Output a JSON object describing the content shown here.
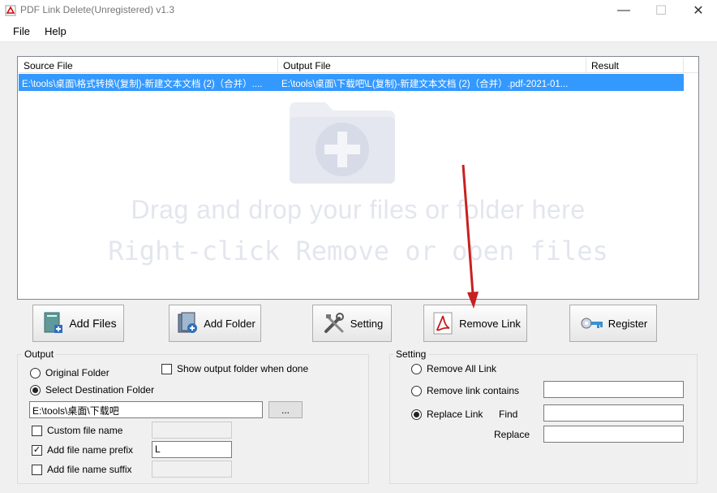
{
  "window": {
    "title": "PDF Link Delete(Unregistered) v1.3",
    "minimize": "—",
    "maximize": "☐",
    "close": "✕"
  },
  "menu": {
    "file": "File",
    "help": "Help"
  },
  "list": {
    "headers": {
      "source": "Source File",
      "output": "Output File",
      "result": "Result"
    },
    "rows": [
      {
        "source": "E:\\tools\\桌面\\格式转换\\(复制)-新建文本文档 (2)（合并）....",
        "output": "E:\\tools\\桌面\\下载吧\\L(复制)-新建文本文档 (2)（合并）.pdf-2021-01...",
        "result": ""
      }
    ],
    "drop_line1": "Drag and drop your files or folder here",
    "drop_line2": "Right-click Remove or open files"
  },
  "buttons": {
    "add_files": "Add Files",
    "add_folder": "Add Folder",
    "setting": "Setting",
    "remove_link": "Remove Link",
    "register": "Register"
  },
  "output": {
    "title": "Output",
    "original_folder": "Original Folder",
    "show_output": "Show output folder when done",
    "select_dest": "Select Destination Folder",
    "dest_path": "E:\\tools\\桌面\\下载吧",
    "browse": "...",
    "custom_name": "Custom file name",
    "custom_name_value": "",
    "prefix_label": "Add file name prefix",
    "prefix_value": "L",
    "suffix_label": "Add file name suffix",
    "suffix_value": ""
  },
  "setting": {
    "title": "Setting",
    "remove_all": "Remove All Link",
    "remove_contains": "Remove link contains",
    "remove_contains_value": "",
    "replace_link": "Replace Link",
    "find_label": "Find",
    "find_value": "",
    "replace_label": "Replace",
    "replace_value": ""
  }
}
